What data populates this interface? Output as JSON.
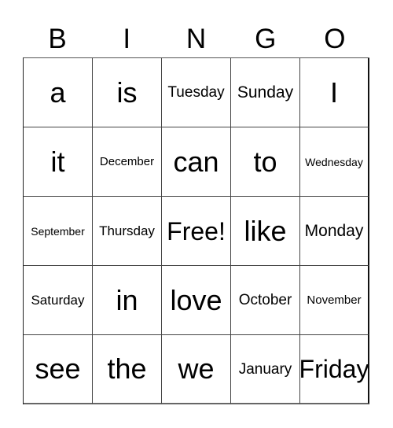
{
  "header": {
    "letters": [
      "B",
      "I",
      "N",
      "G",
      "O"
    ]
  },
  "card": {
    "rows": [
      [
        "a",
        "is",
        "Tuesday",
        "Sunday",
        "I"
      ],
      [
        "it",
        "December",
        "can",
        "to",
        "Wednesday"
      ],
      [
        "September",
        "Thursday",
        "Free!",
        "like",
        "Monday"
      ],
      [
        "Saturday",
        "in",
        "love",
        "October",
        "November"
      ],
      [
        "see",
        "the",
        "we",
        "January",
        "Friday"
      ]
    ],
    "free_space": "Free!"
  }
}
